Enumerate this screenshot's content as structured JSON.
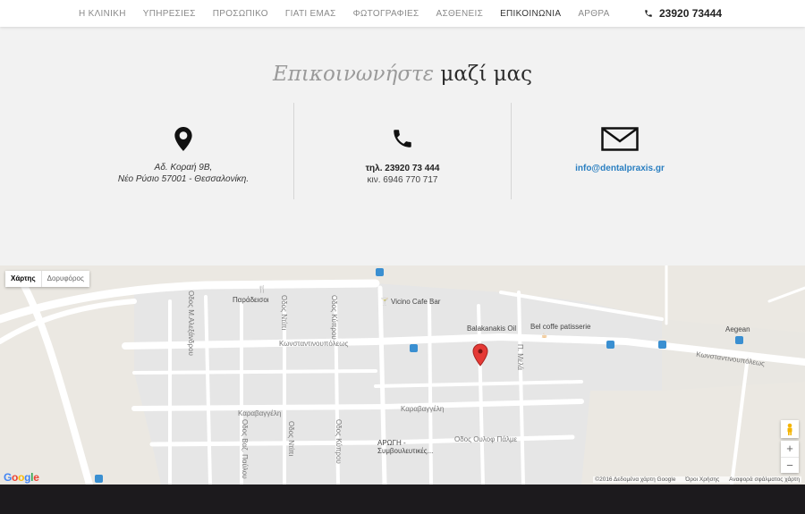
{
  "nav": {
    "items": [
      {
        "label": "Η ΚΛΙΝΙΚΗ",
        "active": false
      },
      {
        "label": "ΥΠΗΡΕΣΙΕΣ",
        "active": false
      },
      {
        "label": "ΠΡΟΣΩΠΙΚΟ",
        "active": false
      },
      {
        "label": "ΓΙΑΤΙ ΕΜΑΣ",
        "active": false
      },
      {
        "label": "ΦΩΤΟΓΡΑΦΙΕΣ",
        "active": false
      },
      {
        "label": "ΑΣΘΕΝΕΙΣ",
        "active": false
      },
      {
        "label": "ΕΠΙΚΟΙΝΩΝΙΑ",
        "active": true
      },
      {
        "label": "ΑΡΘΡΑ",
        "active": false
      }
    ],
    "phone": "23920 73444",
    "phone_icon": "phone-icon"
  },
  "contact": {
    "title_light": "Επικοινωνήστε",
    "title_dark": "μαζί μας",
    "address_icon": "location-pin-icon",
    "address_line1": "Αδ. Κοραή 9Β,",
    "address_line2": "Νέο Ρύσιο 57001 - Θεσσαλονίκη.",
    "phone_icon": "phone-icon",
    "tel": "τηλ. 23920 73 444",
    "mobile": "κιν. 6946 770 717",
    "email_icon": "envelope-icon",
    "email": "info@dentalpraxis.gr"
  },
  "map": {
    "toggle_map": "Χάρτης",
    "toggle_satellite": "Δορυφόρος",
    "places": {
      "paradeisoi": "Παράδεισοι",
      "vicino": "Vicino Cafe Bar",
      "balakanakis": "Balakanakis Oil",
      "bel": "Bel coffe patisserie",
      "aegean": "Aegean",
      "arogi1": "ΑΡΩΓΗ -",
      "arogi2": "Συμβουλευτικές..."
    },
    "streets": {
      "konst1": "Κωνσταντινουπόλεως",
      "konst2": "Κωνσταντινουπόλεως",
      "karav1": "Καραβαγγέλη",
      "karav2": "Καραβαγγέλη",
      "oulof": "Οδος Ουλοφ Πάλμε",
      "aleksandrou": "Οδος Μ.Αλεξάνδρου",
      "ntipi": "Οδος Ντίπι",
      "kyprou1": "Οδος Κύπρου",
      "vaz": "Οδος Βαζ. Παύλου",
      "ntipi2": "Οδος Ντίπι",
      "kyprou2": "Οδος Κύπρου",
      "mela": "Π. Μελά"
    },
    "zoom_in": "+",
    "zoom_out": "−",
    "google": "Google",
    "attribution_data": "©2016 Δεδομένα χάρτη Google",
    "attribution_terms": "Όροι Χρήσης",
    "attribution_report": "Αναφορά σφάλματος χάρτη",
    "marker_icon": "map-marker-icon",
    "pegman_icon": "pegman-icon",
    "colors": {
      "road": "#ffffff",
      "block": "#e6e6e6",
      "background": "#ebe8e2",
      "marker": "#e53935"
    }
  }
}
